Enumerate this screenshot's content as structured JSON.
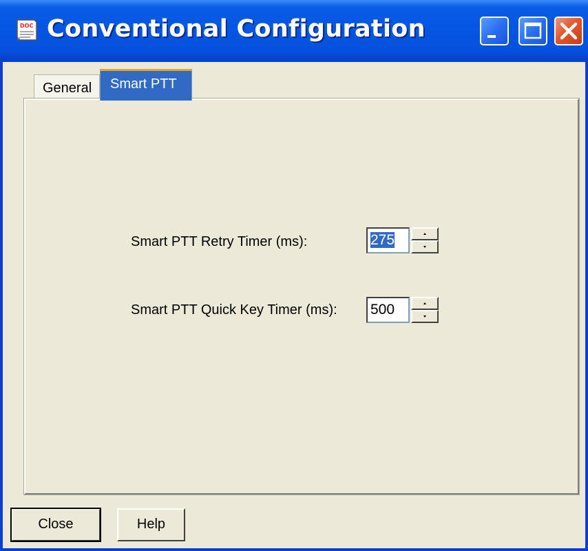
{
  "window": {
    "title": "Conventional Configuration",
    "icon": "doc-icon",
    "controls": {
      "minimize": "minimize-icon",
      "maximize": "maximize-icon",
      "close": "close-icon"
    }
  },
  "tabs": [
    {
      "label": "General",
      "active": false
    },
    {
      "label": "Smart PTT",
      "active": true
    }
  ],
  "fields": {
    "retry": {
      "label": "Smart PTT Retry Timer (ms):",
      "value": "275",
      "selected": true
    },
    "quick_key": {
      "label": "Smart PTT Quick Key Timer (ms):",
      "value": "500",
      "selected": false
    }
  },
  "buttons": {
    "close_label": "Close",
    "help_label": "Help"
  },
  "colors": {
    "titlebar": "#0556e3",
    "selection": "#316ac5",
    "active_tab_highlight": "#e6a92e",
    "close_button": "#e3582e",
    "dialog_background": "#ece9d8"
  }
}
